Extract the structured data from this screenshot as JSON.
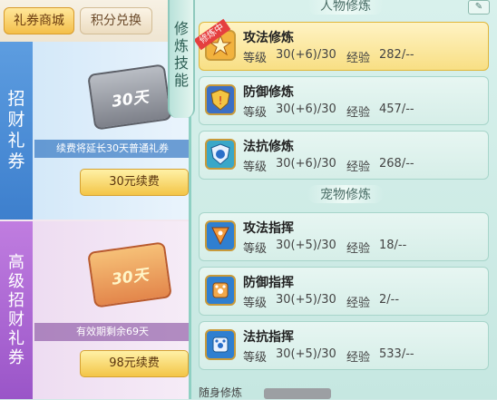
{
  "shop": {
    "tabs": [
      {
        "label": "礼券商城",
        "active": true
      },
      {
        "label": "积分兑换",
        "active": false
      }
    ],
    "cards": [
      {
        "vertical_label": [
          "招",
          "财",
          "礼",
          "券"
        ],
        "ticket_text": "30天",
        "strip_text": "续费将延长30天普通礼券",
        "button_label": "30元续费"
      },
      {
        "vertical_label": [
          "高",
          "级",
          "招",
          "财",
          "礼",
          "券"
        ],
        "ticket_text": "30天",
        "strip_text": "有效期剩余69天",
        "button_label": "98元续费"
      }
    ]
  },
  "side_tab": {
    "chars": [
      "修",
      "炼",
      "技",
      "能"
    ]
  },
  "panel": {
    "character_title": "人物修炼",
    "pet_title": "宠物修炼",
    "level_label": "等级",
    "exp_label": "经验",
    "in_training_badge": "修炼中",
    "character_skills": [
      {
        "name": "攻法修炼",
        "level": "30(+6)/30",
        "exp": "282/--",
        "selected": true,
        "icon": "attack-magic-icon"
      },
      {
        "name": "防御修炼",
        "level": "30(+6)/30",
        "exp": "457/--",
        "selected": false,
        "icon": "defense-shield-icon"
      },
      {
        "name": "法抗修炼",
        "level": "30(+6)/30",
        "exp": "268/--",
        "selected": false,
        "icon": "magic-resist-icon"
      }
    ],
    "pet_skills": [
      {
        "name": "攻法指挥",
        "level": "30(+5)/30",
        "exp": "18/--",
        "icon": "pet-attack-icon"
      },
      {
        "name": "防御指挥",
        "level": "30(+5)/30",
        "exp": "2/--",
        "icon": "pet-defense-icon"
      },
      {
        "name": "法抗指挥",
        "level": "30(+5)/30",
        "exp": "533/--",
        "icon": "pet-resist-icon"
      }
    ],
    "bottom_label": "随身修炼"
  }
}
